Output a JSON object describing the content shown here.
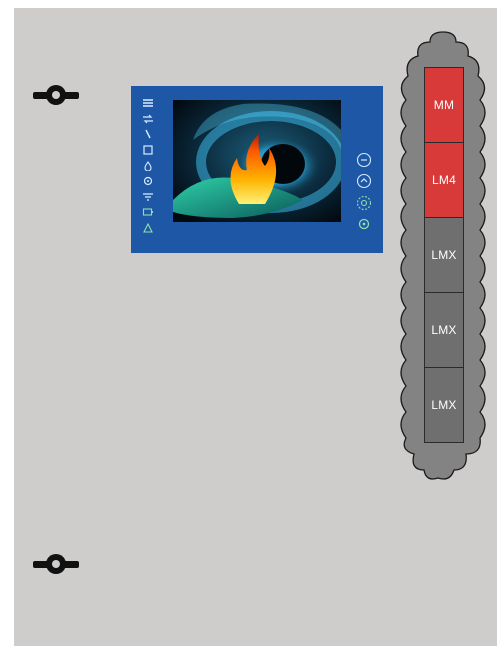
{
  "modules": [
    {
      "label": "MM",
      "color": "#d83a3a"
    },
    {
      "label": "LM4",
      "color": "#d83a3a"
    },
    {
      "label": "LMX",
      "color": "#6f6f6f"
    },
    {
      "label": "LMX",
      "color": "#6f6f6f"
    },
    {
      "label": "LMX",
      "color": "#6f6f6f"
    }
  ],
  "hmi": {
    "frame_color": "#1f57a7",
    "left_icons": [
      "menu-icon",
      "flow-icon",
      "arrow-icon",
      "door-icon",
      "flame-icon",
      "gear-icon",
      "filter-icon",
      "battery-icon",
      "alarm-icon"
    ],
    "right_buttons": [
      "previous-button",
      "home-button",
      "next-button",
      "power-button"
    ]
  },
  "cabinet_color": "#cfcccc"
}
